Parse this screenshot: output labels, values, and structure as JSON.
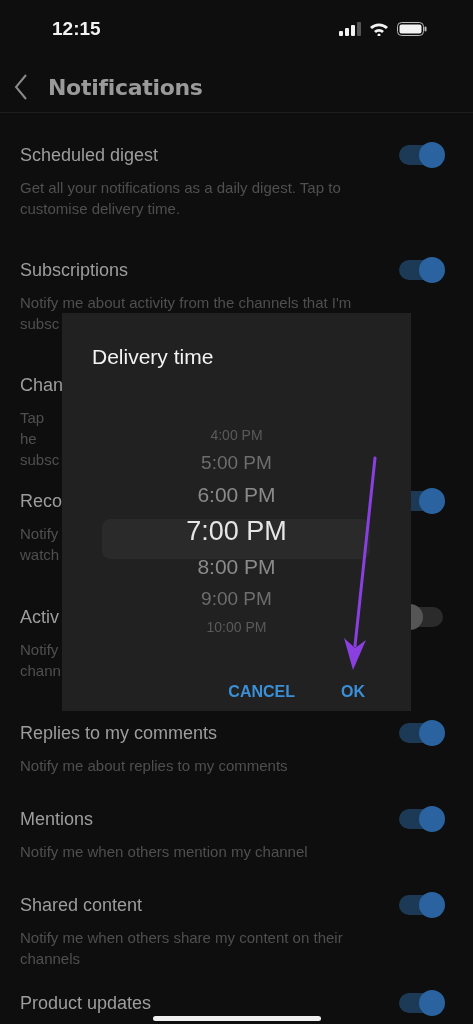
{
  "status_bar": {
    "time": "12:15"
  },
  "header": {
    "title": "Notifications"
  },
  "settings": [
    {
      "title": "Scheduled digest",
      "description": "Get all your notifications as a daily digest. Tap to customise delivery time.",
      "on": true
    },
    {
      "title": "Subscriptions",
      "description": "Notify me about activity from the channels that I'm subsc",
      "on": true
    },
    {
      "title": "Chan",
      "description": "Tap he subsc",
      "kind": "covered"
    },
    {
      "title": "Reco",
      "description": "Notify watch",
      "kind": "covered",
      "on": true
    },
    {
      "title": "Activ",
      "description": "Notify chann",
      "kind": "covered",
      "on": false
    },
    {
      "title": "Replies to my comments",
      "description": "Notify me about replies to my comments",
      "on": true
    },
    {
      "title": "Mentions",
      "description": "Notify me when others mention my channel",
      "on": true
    },
    {
      "title": "Shared content",
      "description": "Notify me when others share my content on their channels",
      "on": true
    },
    {
      "title": "Product updates",
      "on": true
    }
  ],
  "dialog": {
    "title": "Delivery time",
    "times": [
      {
        "label": "4:00 PM",
        "selected": false
      },
      {
        "label": "5:00 PM",
        "selected": false
      },
      {
        "label": "6:00 PM",
        "selected": false
      },
      {
        "label": "7:00 PM",
        "selected": true
      },
      {
        "label": "8:00 PM",
        "selected": false
      },
      {
        "label": "9:00 PM",
        "selected": false
      },
      {
        "label": "10:00 PM",
        "selected": false
      }
    ],
    "buttons": [
      "CANCEL",
      "OK"
    ]
  }
}
